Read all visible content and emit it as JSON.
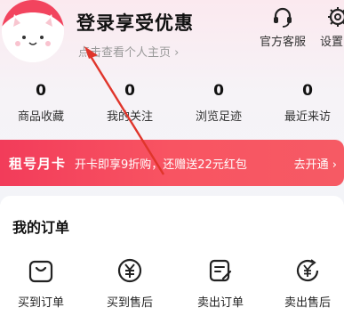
{
  "header": {
    "login_title": "登录享受优惠",
    "profile_link": "点击查看个人主页",
    "service_label": "官方客服",
    "settings_label": "设置"
  },
  "stats": [
    {
      "value": "0",
      "label": "商品收藏"
    },
    {
      "value": "0",
      "label": "我的关注"
    },
    {
      "value": "0",
      "label": "浏览足迹"
    },
    {
      "value": "0",
      "label": "最近来访"
    }
  ],
  "banner": {
    "title": "租号月卡",
    "desc": "开卡即享9折购，还赠送22元红包",
    "cta": "去开通"
  },
  "orders": {
    "title": "我的订单",
    "items": [
      {
        "label": "买到订单",
        "icon": "bag-icon"
      },
      {
        "label": "买到售后",
        "icon": "yen-circle-icon"
      },
      {
        "label": "卖出订单",
        "icon": "order-edit-icon"
      },
      {
        "label": "卖出售后",
        "icon": "yen-refund-icon"
      }
    ]
  },
  "colors": {
    "accent": "#f23c5a",
    "banner_end": "#f65a64"
  }
}
